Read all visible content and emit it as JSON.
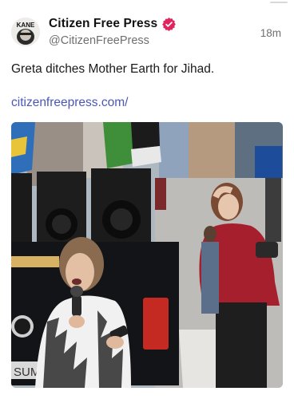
{
  "post": {
    "author": {
      "display_name": "Citizen Free Press",
      "handle": "@CitizenFreePress",
      "verified": true,
      "avatar_text": "KANE"
    },
    "timestamp": "18m",
    "text": "Greta ditches Mother Earth for Jihad.",
    "link": "citizenfreepress.com/",
    "media": {
      "truck_plate_text": "SUM"
    }
  },
  "colors": {
    "verified_badge": "#e0245e",
    "link": "#4a57b8",
    "muted_text": "#6f6f6f"
  }
}
